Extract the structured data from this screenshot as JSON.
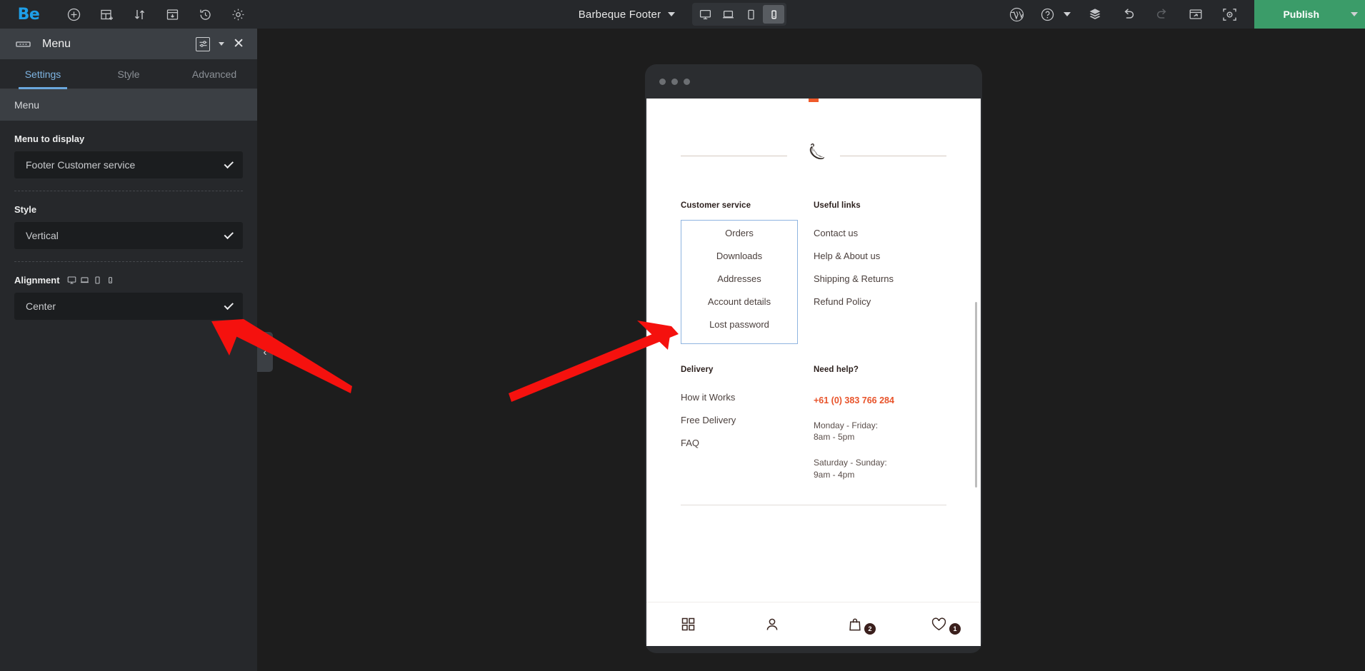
{
  "topbar": {
    "logo": "Be",
    "left_icons": [
      "add-element-icon",
      "add-section-icon",
      "sort-icon",
      "page-settings-icon",
      "history-icon",
      "settings-gear-icon"
    ],
    "document_title": "Barbeque Footer",
    "devices": [
      {
        "name": "desktop",
        "label": "Desktop",
        "active": false
      },
      {
        "name": "laptop",
        "label": "Laptop",
        "active": false
      },
      {
        "name": "tablet",
        "label": "Tablet",
        "active": false
      },
      {
        "name": "mobile",
        "label": "Mobile",
        "active": true
      }
    ],
    "right_icons": [
      "wordpress-icon",
      "help-icon",
      "layers-icon",
      "undo-icon",
      "redo-icon",
      "preview-icon",
      "focus-icon"
    ],
    "publish_label": "Publish"
  },
  "panel": {
    "widget_title": "Menu",
    "tabs": [
      {
        "label": "Settings",
        "active": true
      },
      {
        "label": "Style",
        "active": false
      },
      {
        "label": "Advanced",
        "active": false
      }
    ],
    "section_title": "Menu",
    "fields": [
      {
        "label": "Menu to display",
        "value": "Footer Customer service",
        "responsive": false
      },
      {
        "label": "Style",
        "value": "Vertical",
        "responsive": false
      },
      {
        "label": "Alignment",
        "value": "Center",
        "responsive": true
      }
    ],
    "collapse_glyph": "‹"
  },
  "preview": {
    "columns_row1": [
      {
        "heading": "Customer service",
        "highlighted": true,
        "links": [
          "Orders",
          "Downloads",
          "Addresses",
          "Account details",
          "Lost password"
        ]
      },
      {
        "heading": "Useful links",
        "highlighted": false,
        "links": [
          "Contact us",
          "Help & About us",
          "Shipping & Returns",
          "Refund Policy"
        ]
      }
    ],
    "columns_row2": [
      {
        "heading": "Delivery",
        "links": [
          "How it Works",
          "Free Delivery",
          "FAQ"
        ]
      },
      {
        "heading": "Need help?",
        "phone": "+61 (0) 383 766 284",
        "hours": [
          {
            "days": "Monday - Friday:",
            "time": "8am - 5pm"
          },
          {
            "days": "Saturday - Sunday:",
            "time": "9am - 4pm"
          }
        ]
      }
    ],
    "bottom_nav": [
      {
        "icon": "grid-icon",
        "badge": ""
      },
      {
        "icon": "user-icon",
        "badge": ""
      },
      {
        "icon": "shopping-bag-icon",
        "badge": "2"
      },
      {
        "icon": "heart-icon",
        "badge": "1"
      }
    ]
  },
  "colors": {
    "brand_blue": "#1e9fe8",
    "publish_green": "#3b9c69",
    "accent_orange": "#e8532a",
    "highlight_blue": "#8fb4e0",
    "annotation_red": "#f5110e"
  }
}
